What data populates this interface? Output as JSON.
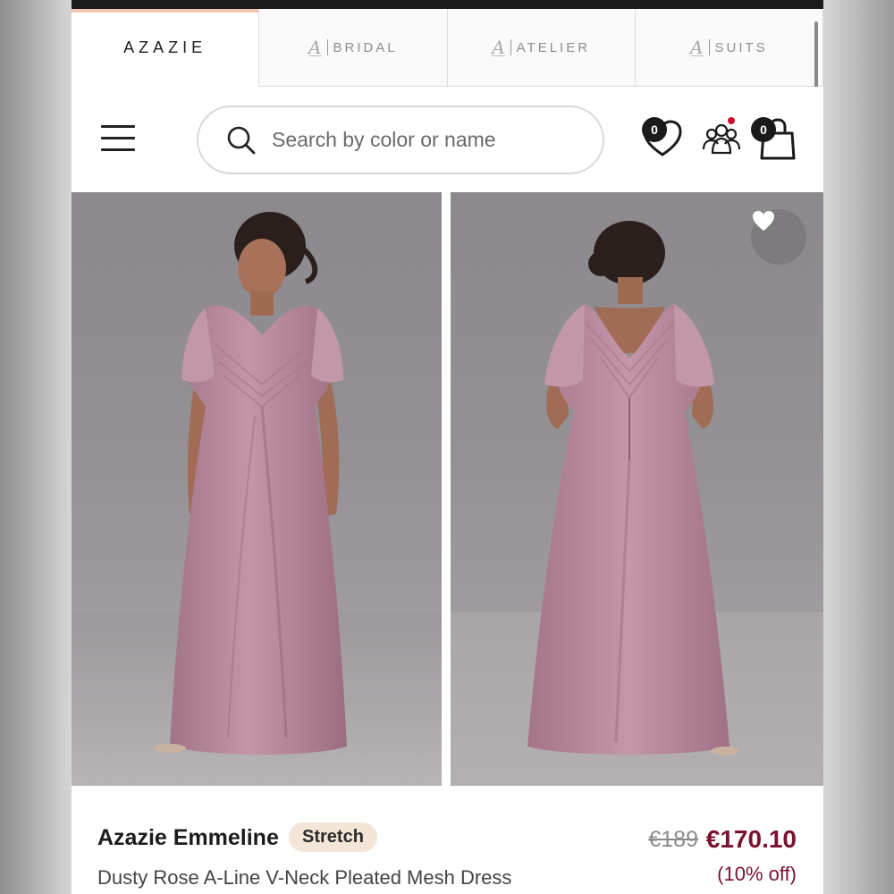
{
  "brand_tabs": {
    "main": "AZAZIE",
    "bridal": "BRIDAL",
    "atelier": "ATELIER",
    "suits": "SUITS",
    "sub_mark": "A"
  },
  "header": {
    "search_placeholder": "Search by color or name",
    "wishlist_count": "0",
    "cart_count": "0"
  },
  "product": {
    "name": "Azazie Emmeline",
    "badge": "Stretch",
    "description": "Dusty Rose A-Line V-Neck Pleated Mesh Dress",
    "original_price": "€189",
    "sale_price": "€170.10",
    "discount": "(10% off)"
  },
  "colors": {
    "accent_tab": "#f3c7b4",
    "price": "#7a1230",
    "badge_bg": "#f3e6d8",
    "dress": "#b98a9d",
    "notification": "#c8102e"
  },
  "icons": [
    "hamburger-menu-icon",
    "search-icon",
    "heart-icon",
    "community-icon",
    "shopping-bag-icon",
    "favorite-heart-icon"
  ]
}
